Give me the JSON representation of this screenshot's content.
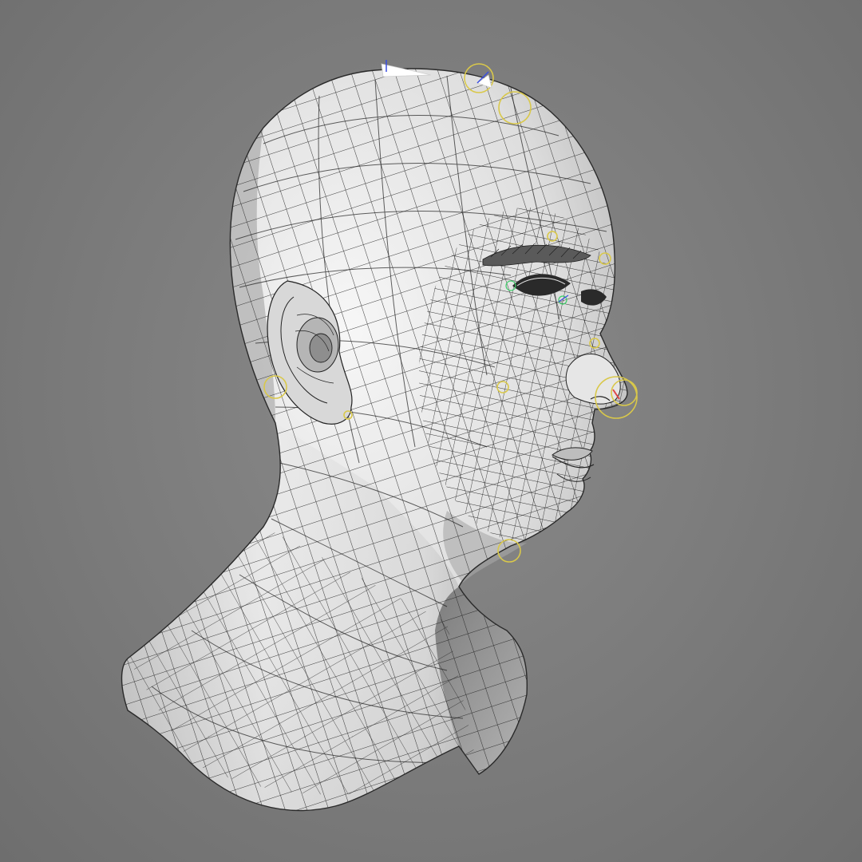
{
  "scene": {
    "subject": "wireframe-head-mesh",
    "colors": {
      "background": "#7b7b7b",
      "surface_light": "#f2f2f2",
      "surface_mid": "#cfcfcf",
      "surface_dark": "#8d8d8d",
      "wire": "#1e1e1e",
      "rig_gizmo": "#d9c84a",
      "rig_accent_green": "#3ecf6a",
      "rig_accent_red": "#e04848",
      "rig_accent_blue": "#3a4ee0"
    },
    "icons": [
      "head-mesh",
      "rig-gizmo"
    ]
  }
}
